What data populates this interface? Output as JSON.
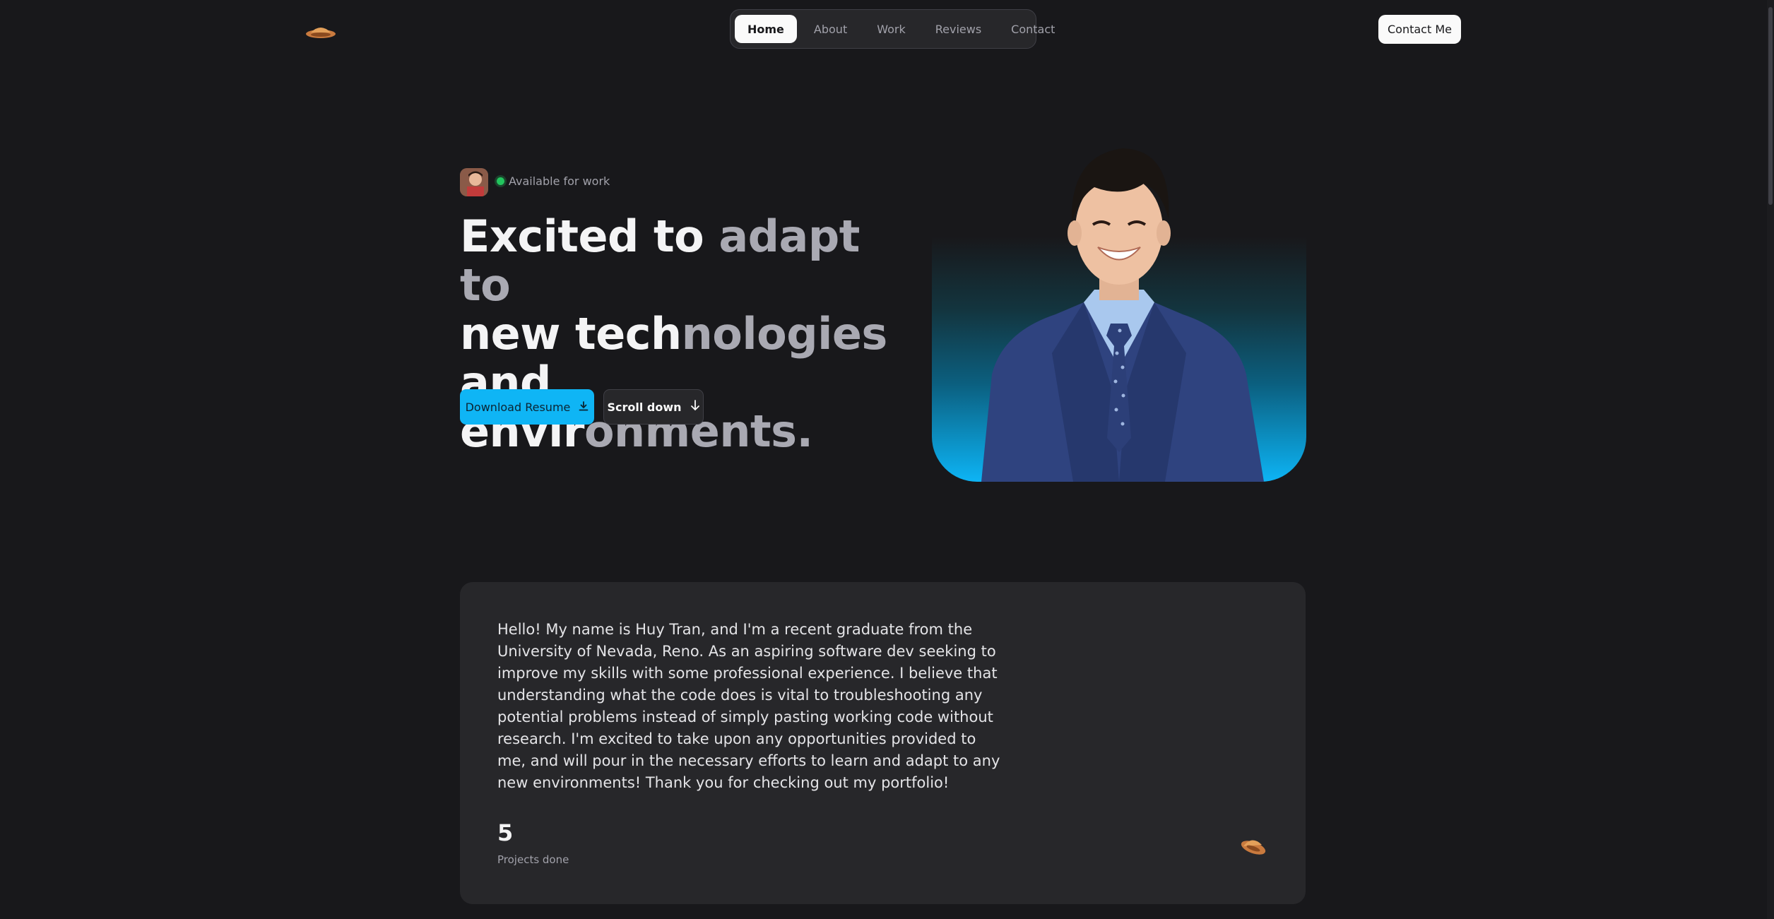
{
  "header": {
    "nav": [
      {
        "label": "Home",
        "active": true
      },
      {
        "label": "About",
        "active": false
      },
      {
        "label": "Work",
        "active": false
      },
      {
        "label": "Reviews",
        "active": false
      },
      {
        "label": "Contact",
        "active": false
      }
    ],
    "contact_button": "Contact Me"
  },
  "hero": {
    "status": "Available for work",
    "headline_bright": "Excited to ",
    "headline_dim_1": "adapt to",
    "headline_bright_2": "new tech",
    "headline_dim_2": "nologies",
    "headline_bright_3": "and envir",
    "headline_dim_3": "onments.",
    "download_button": "Download Resume",
    "scroll_button": "Scroll down"
  },
  "about": {
    "text": "Hello! My name is Huy Tran, and I'm a recent graduate from the University of Nevada, Reno. As an aspiring software dev seeking to improve my skills with some professional experience. I believe that understanding what the code does is vital to troubleshooting any potential problems instead of simply pasting working code without research. I'm excited to take upon any opportunities provided to me, and will pour in the necessary efforts to learn and adapt to any new environments! Thank you for checking out my portfolio!",
    "stat_number": "5",
    "stat_label": "Projects done"
  },
  "colors": {
    "accent": "#0fb5f5",
    "status": "#22c55e",
    "background": "#18181b",
    "card": "#27272a"
  },
  "icons": [
    "logo-icon",
    "download-icon",
    "arrow-down-icon"
  ]
}
